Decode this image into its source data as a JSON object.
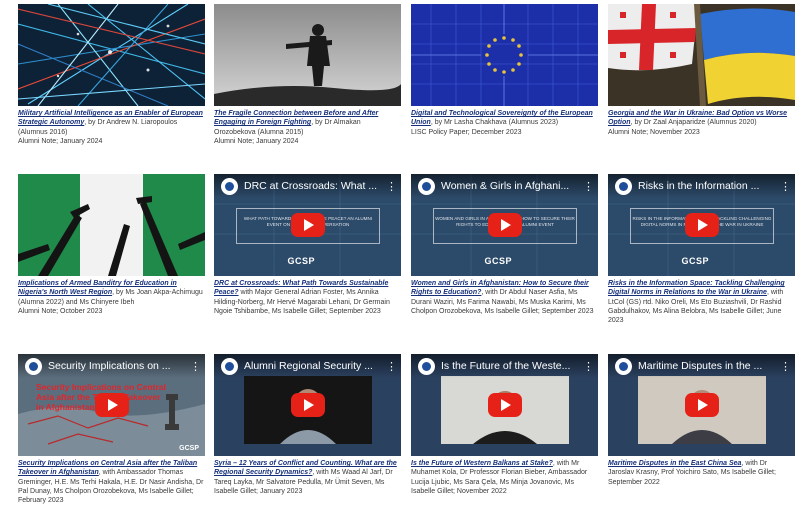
{
  "colors": {
    "title_link": "#16307a",
    "caption_text": "#3a3a3a",
    "youtube_red": "#e62117",
    "video_bg": "#2f4f6e"
  },
  "icons": {
    "play": "youtube-play-icon",
    "channel": "gcsp-channel-logo",
    "menu": "kebab-menu-icon"
  },
  "rows": [
    {
      "cards": [
        {
          "title": "Military Artificial Intelligence as an Enabler of European Strategic Autonomy",
          "authors": ", by Dr Andrew N. Liaropoulos (Alumnus 2016)",
          "meta": "Alumni Note; January 2024"
        },
        {
          "title": "The Fragile Connection between Before and After Engaging in Foreign Fighting",
          "authors": ", by Dr Almakan Orozobekova (Alumna 2015)",
          "meta": "Alumni Note; January 2024"
        },
        {
          "title": "Digital and Technological Sovereignty of the European Union",
          "authors": ", by Mr Lasha Chakhava (Alumnus 2023)",
          "meta": "LISC Policy Paper; December 2023"
        },
        {
          "title": "Georgia and the War in Ukraine: Bad Option vs Worse Option",
          "authors": ", by Dr Zaal Anjaparidze (Alumnus 2020)",
          "meta": "Alumni Note; November 2023"
        }
      ]
    },
    {
      "cards": [
        {
          "title": "Implications of Armed Banditry for Education in Nigeria's North West Region",
          "authors": ", by Ms Joan Akpa-Achimugu (Alumna 2022) and Ms Chinyere Ibeh",
          "meta": "Alumni Note; October 2023"
        },
        {
          "video_title": "DRC at Crossroads: What ...",
          "slide_text": "WHAT PATH TOWARDS SUSTAINABLE PEACE? AN ALUMNI EVENT ON THE DRC CONVERSATION",
          "channel": "GCSP",
          "title": "DRC at Crossroads: What Path Towards Sustainable Peace?",
          "authors": " with Major General Adrian Foster, Ms Annika Hilding-Norberg, Mr Hervé Magarabi Lehani, Dr Germain Ngoie Tshibambe, Ms Isabelle Gillet; September 2023",
          "meta": ""
        },
        {
          "video_title": "Women & Girls in Afghani...",
          "slide_text": "WOMEN AND GIRLS IN AFGHANISTAN: HOW TO SECURE THEIR RIGHTS TO EDUCATION? AN ALUMNI EVENT",
          "channel": "GCSP",
          "title": "Women and Girls in Afghanistan: How to Secure their Rights to Education?",
          "authors": ", with Dr Abdul Naser Asfia, Ms Durani Waziri, Ms Farima Nawabi, Ms Muska Karimi, Ms Cholpon Orozobekova, Ms Isabelle Gillet; September 2023",
          "meta": ""
        },
        {
          "video_title": "Risks in the Information ...",
          "slide_text": "RISKS IN THE INFORMATION SPACE: TACKLING CHALLENGING DIGITAL NORMS IN RELATION TO THE WAR IN UKRAINE",
          "channel": "GCSP",
          "title": "Risks in the Information Space: Tackling Challenging Digital Norms in Relations to the War in Ukraine",
          "authors": ", with LtCol (GS) rtd. Niko Oreli, Ms Eto Buziashvili, Dr Rashid Gabdulhakov, Ms Alina Belobra, Ms Isabelle Gillet; June 2023",
          "meta": ""
        }
      ]
    },
    {
      "cards": [
        {
          "video_title": "Security Implications on ...",
          "overlay_text": "Security Implications on Central Asia after the Taliban Takeover in Afghanistan",
          "channel": "GCSP",
          "title": "Security Implications on Central Asia after the Taliban Takeover in Afghanistan",
          "authors": ", with Ambassador Thomas Greminger, H.E. Ms Terhi Hakala, H.E. Dr Nasir Andisha, Dr Pal Dunay, Ms Cholpon Orozobekova, Ms Isabelle Gillet; February 2023",
          "meta": ""
        },
        {
          "video_title": "Alumni Regional Security ...",
          "title": "Syria – 12 Years of Conflict and Counting. What are the Regional Security Dynamics?",
          "authors": ", with Ms Waad Al Jarf, Dr Tareq Layka, Mr Salvatore Pedulla, Mr Ümit Seven, Ms Isabelle Gillet; January 2023",
          "meta": ""
        },
        {
          "video_title": "Is the Future of the Weste...",
          "title": "Is the Future of Western Balkans at Stake?",
          "authors": ", with Mr Muhamet Kola, Dr Professor Florian Bieber, Ambassador Lucija Ljubic, Ms Sara Çela, Ms Minja Jovanovic, Ms Isabelle Gillet; November 2022",
          "meta": ""
        },
        {
          "video_title": "Maritime Disputes in the ...",
          "title": "Maritime Disputes in the East China Sea",
          "authors": ", with Dr Jaroslav Krasny, Prof Yoichiro Sato, Ms Isabelle Gillet; September 2022",
          "meta": ""
        }
      ]
    }
  ]
}
